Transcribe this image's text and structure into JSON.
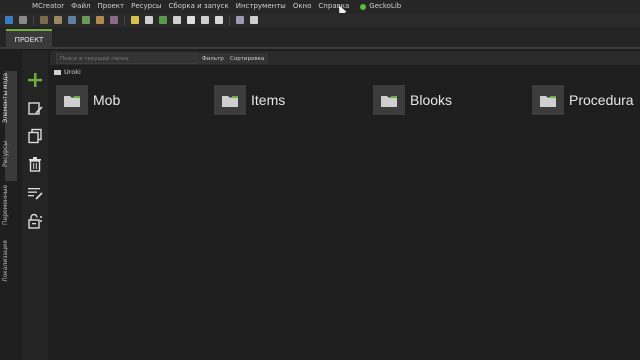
{
  "menubar": {
    "items": [
      "MCreator",
      "Файл",
      "Проект",
      "Ресурсы",
      "Сборка и запуск",
      "Инструменты",
      "Окно",
      "Справка"
    ],
    "plugin": "GeckoLib"
  },
  "tabs": {
    "project": "ПРОЕКТ"
  },
  "sidebar": {
    "labels": [
      "Элементы мода",
      "Ресурсы",
      "Переменные",
      "Локализация"
    ],
    "actions": [
      "add-icon",
      "edit-icon",
      "duplicate-icon",
      "delete-icon",
      "list-edit-icon",
      "lock-icon"
    ]
  },
  "search": {
    "placeholder": "Поиск в текущей папке",
    "filter_label": "Фильтр",
    "sort_label": "Сортировка"
  },
  "breadcrumb": {
    "label": "Uroki"
  },
  "folders": [
    {
      "name": "Mob"
    },
    {
      "name": "Items"
    },
    {
      "name": "Blooks"
    },
    {
      "name": "Procedura"
    }
  ],
  "colors": {
    "accent": "#6fae3d",
    "background": "#1e1e1e",
    "tile": "#3c3c3c"
  }
}
